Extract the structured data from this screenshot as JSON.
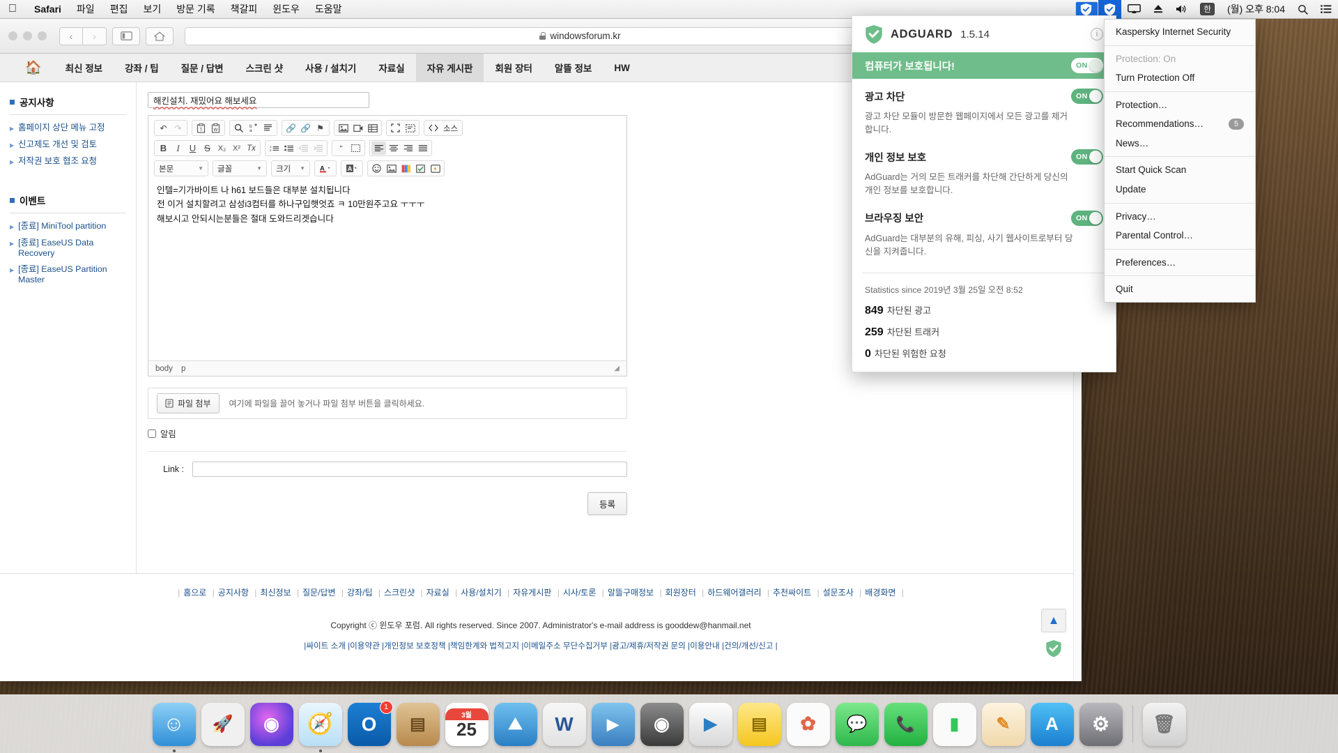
{
  "menubar": {
    "apple_icon": "apple-icon",
    "items": [
      "Safari",
      "파일",
      "편집",
      "보기",
      "방문 기록",
      "책갈피",
      "윈도우",
      "도움말"
    ],
    "right": {
      "adguard_icon": "adguard-shield-icon",
      "kaspersky_icon": "kaspersky-shield-icon",
      "airplay_icon": "airplay-icon",
      "eject_icon": "eject-icon",
      "volume_icon": "volume-icon",
      "input_source": "한",
      "clock": "(월) 오후 8:04",
      "search_icon": "spotlight-search-icon",
      "control_center_icon": "notification-center-icon"
    }
  },
  "safari": {
    "address": "windowsforum.kr",
    "lock_icon": "lock-icon",
    "back_icon": "back-chevron-icon",
    "forward_icon": "forward-chevron-icon",
    "sidebar_icon": "sidebar-toggle-icon",
    "home_icon": "home-icon",
    "share_icon": "share-icon",
    "tabs_icon": "show-tabs-icon",
    "newtab_icon": "new-tab-icon"
  },
  "site": {
    "nav": {
      "home_icon": "home-icon",
      "items": [
        {
          "label": "최신 정보",
          "active": false
        },
        {
          "label": "강좌 / 팁",
          "active": false
        },
        {
          "label": "질문 / 답변",
          "active": false
        },
        {
          "label": "스크린 샷",
          "active": false
        },
        {
          "label": "사용 / 설치기",
          "active": false
        },
        {
          "label": "자료실",
          "active": false
        },
        {
          "label": "자유 게시판",
          "active": true
        },
        {
          "label": "회원 장터",
          "active": false
        },
        {
          "label": "알뜰 정보",
          "active": false
        },
        {
          "label": "HW",
          "active": false
        }
      ]
    },
    "sidebar": {
      "notice_title": "공지사항",
      "notice_items": [
        "홈페이지 상단 메뉴 고정",
        "신고제도 개선 및 검토",
        "저작권 보호 협조 요청"
      ],
      "event_title": "이벤트",
      "event_items": [
        "[종료] MiniTool partition",
        "[종료] EaseUS Data Recovery",
        "[종료] EaseUS Partition Master"
      ]
    },
    "editor": {
      "title_value": "해킨설치. 재밌어요 해보세요",
      "toolbar_groups": [
        {
          "name": "history",
          "buttons": [
            "undo-icon",
            "redo-icon"
          ]
        },
        {
          "name": "paste",
          "buttons": [
            "paste-text-icon",
            "paste-word-icon"
          ]
        },
        {
          "name": "find",
          "buttons": [
            "search-icon",
            "replace-icon",
            "select-all-icon"
          ]
        },
        {
          "name": "link",
          "buttons": [
            "link-icon",
            "unlink-icon",
            "anchor-flag-icon"
          ]
        },
        {
          "name": "media",
          "buttons": [
            "image-icon",
            "video-icon",
            "table-icon"
          ]
        },
        {
          "name": "view",
          "buttons": [
            "maximize-icon",
            "show-blocks-icon"
          ]
        },
        {
          "name": "source",
          "buttons": [
            "source-icon"
          ],
          "label": "소스"
        }
      ],
      "format_buttons": [
        "B",
        "I",
        "U",
        "S",
        "X₂",
        "X²",
        "Tx"
      ],
      "list_buttons": [
        "numbered-list-icon",
        "bulleted-list-icon",
        "outdent-icon",
        "indent-icon",
        "blockquote-icon",
        "div-container-icon"
      ],
      "align_buttons": [
        "align-left-icon",
        "align-center-icon",
        "align-right-icon",
        "align-justify-icon"
      ],
      "selects": [
        {
          "name": "paragraph-format",
          "value": "본문"
        },
        {
          "name": "font-family",
          "value": "글꼴"
        },
        {
          "name": "font-size",
          "value": "크기"
        }
      ],
      "color_buttons": [
        "text-color-icon",
        "background-color-icon"
      ],
      "insert_buttons": [
        "emoticon-icon",
        "image-insert-icon",
        "color-palette-icon",
        "checkbox-icon",
        "flash-icon"
      ],
      "body_lines": [
        "인텔=기가바이트 나 h61 보드들은 대부분 설치됩니다",
        "전 이거 설치할려고 삼성i3컴터를 하나구입햇엇죠 ㅋ 10만원주고요 ㅜㅜㅜ",
        "해보시고 안되시는분들은 절대 도와드리겟습니다"
      ],
      "status_path": [
        "body",
        "p"
      ],
      "resize_handle": "resize-grip-icon"
    },
    "attach": {
      "button_label": "파일 첨부",
      "button_icon": "attach-file-icon",
      "hint": "여기에 파일을 끌어 놓거나 파일 첨부 버튼을 클릭하세요."
    },
    "notify_label": "알림",
    "link_label": "Link :",
    "link_value": "",
    "submit_label": "등록",
    "footer": {
      "links": [
        "홈으로",
        "공지사항",
        "최신정보",
        "질문/답변",
        "강좌/팁",
        "스크린샷",
        "자료실",
        "사용/설치기",
        "자유게시판",
        "시사/토론",
        "알뜰구매정보",
        "회원장터",
        "하드웨어갤러리",
        "추천싸이트",
        "설문조사",
        "배경화면"
      ],
      "copyright": "Copyright ⓒ 윈도우 포럼. All rights reserved. Since 2007. Administrator's e-mail address is gooddew@hanmail.net",
      "links2": [
        "싸이트 소개",
        "이용약관",
        "개인정보 보호정책",
        "책임한계와 법적고지",
        "이메일주소 무단수집거부",
        "광고/제휴/저작권 문의",
        "이용안내",
        "건의/개선/신고"
      ]
    },
    "to_top_icon": "scroll-to-top-icon"
  },
  "adguard": {
    "logo_icon": "adguard-shield-icon",
    "name": "ADGUARD",
    "version": "1.5.14",
    "info_icon": "info-icon",
    "banner_text": "컴퓨터가 보호됩니다!",
    "banner_toggle": "ON",
    "sections": [
      {
        "title": "광고 차단",
        "toggle": "ON",
        "desc": "광고 차단 모듈이 방문한 웹페이지에서 모든 광고를 제거합니다."
      },
      {
        "title": "개인 정보 보호",
        "toggle": "ON",
        "desc": "AdGuard는 거의 모든 트래커를 차단해 간단하게 당신의 개인 정보를 보호합니다."
      },
      {
        "title": "브라우징 보안",
        "toggle": "ON",
        "desc": "AdGuard는 대부분의 유해, 피싱, 사기 웹사이트로부터 당신을 지켜줍니다."
      }
    ],
    "stats_since": "Statistics since 2019년 3월 25일 오전 8:52",
    "stats": [
      {
        "value": "849",
        "label": "차단된 광고"
      },
      {
        "value": "259",
        "label": "차단된 트래커"
      },
      {
        "value": "0",
        "label": "차단된 위험한 요청"
      }
    ]
  },
  "kaspersky": {
    "title": "Kaspersky Internet Security",
    "groups": [
      [
        {
          "label": "Protection: On",
          "disabled": true
        },
        {
          "label": "Turn Protection Off",
          "disabled": false
        }
      ],
      [
        {
          "label": "Protection…",
          "disabled": false
        },
        {
          "label": "Recommendations…",
          "disabled": false,
          "badge": "5"
        },
        {
          "label": "News…",
          "disabled": false
        }
      ],
      [
        {
          "label": "Start Quick Scan",
          "disabled": false
        },
        {
          "label": "Update",
          "disabled": false
        }
      ],
      [
        {
          "label": "Privacy…",
          "disabled": false
        },
        {
          "label": "Parental Control…",
          "disabled": false
        }
      ],
      [
        {
          "label": "Preferences…",
          "disabled": false
        }
      ],
      [
        {
          "label": "Quit",
          "disabled": false
        }
      ]
    ]
  },
  "dock": {
    "items": [
      {
        "name": "finder",
        "glyph": "☺",
        "color": "#2f8fd8",
        "running": true
      },
      {
        "name": "launchpad",
        "glyph": "🚀",
        "color": "#d8d8d8",
        "running": false
      },
      {
        "name": "siri",
        "glyph": "◉",
        "color": "#7b4bd8",
        "running": false
      },
      {
        "name": "safari",
        "glyph": "🧭",
        "color": "#1e9fe0",
        "running": true
      },
      {
        "name": "outlook",
        "glyph": "O",
        "color": "#0a6cc4",
        "running": false,
        "badge": "1"
      },
      {
        "name": "contacts",
        "glyph": "▤",
        "color": "#c49a57",
        "running": false
      },
      {
        "name": "calendar",
        "glyph": "25",
        "color": "#ffffff",
        "running": false,
        "sublabel": "3월"
      },
      {
        "name": "keynote",
        "glyph": "◰",
        "color": "#3b9fe0",
        "running": false
      },
      {
        "name": "word",
        "glyph": "W",
        "color": "#2a5699",
        "running": false
      },
      {
        "name": "quicktime",
        "glyph": "▶",
        "color": "#4a90d0",
        "running": false
      },
      {
        "name": "dvd-player",
        "glyph": "◎",
        "color": "#4b4b4b",
        "running": false
      },
      {
        "name": "media-player",
        "glyph": "▶",
        "color": "#e8e8e8",
        "running": false
      },
      {
        "name": "notes",
        "glyph": "▤",
        "color": "#ffd84d",
        "running": false
      },
      {
        "name": "photos",
        "glyph": "✿",
        "color": "#f2f2f2",
        "running": false
      },
      {
        "name": "messages",
        "glyph": "💬",
        "color": "#4cd964",
        "running": false
      },
      {
        "name": "facetime",
        "glyph": "📞",
        "color": "#35c759",
        "running": false
      },
      {
        "name": "numbers",
        "glyph": "▮",
        "color": "#35c759",
        "running": false
      },
      {
        "name": "pages",
        "glyph": "✎",
        "color": "#f5a623",
        "running": false
      },
      {
        "name": "app-store",
        "glyph": "A",
        "color": "#1e9fe0",
        "running": false
      },
      {
        "name": "system-preferences",
        "glyph": "⚙",
        "color": "#8e8e93",
        "running": false
      },
      {
        "name": "trash",
        "glyph": "🗑",
        "color": "#d8d8d8",
        "running": false
      }
    ]
  }
}
